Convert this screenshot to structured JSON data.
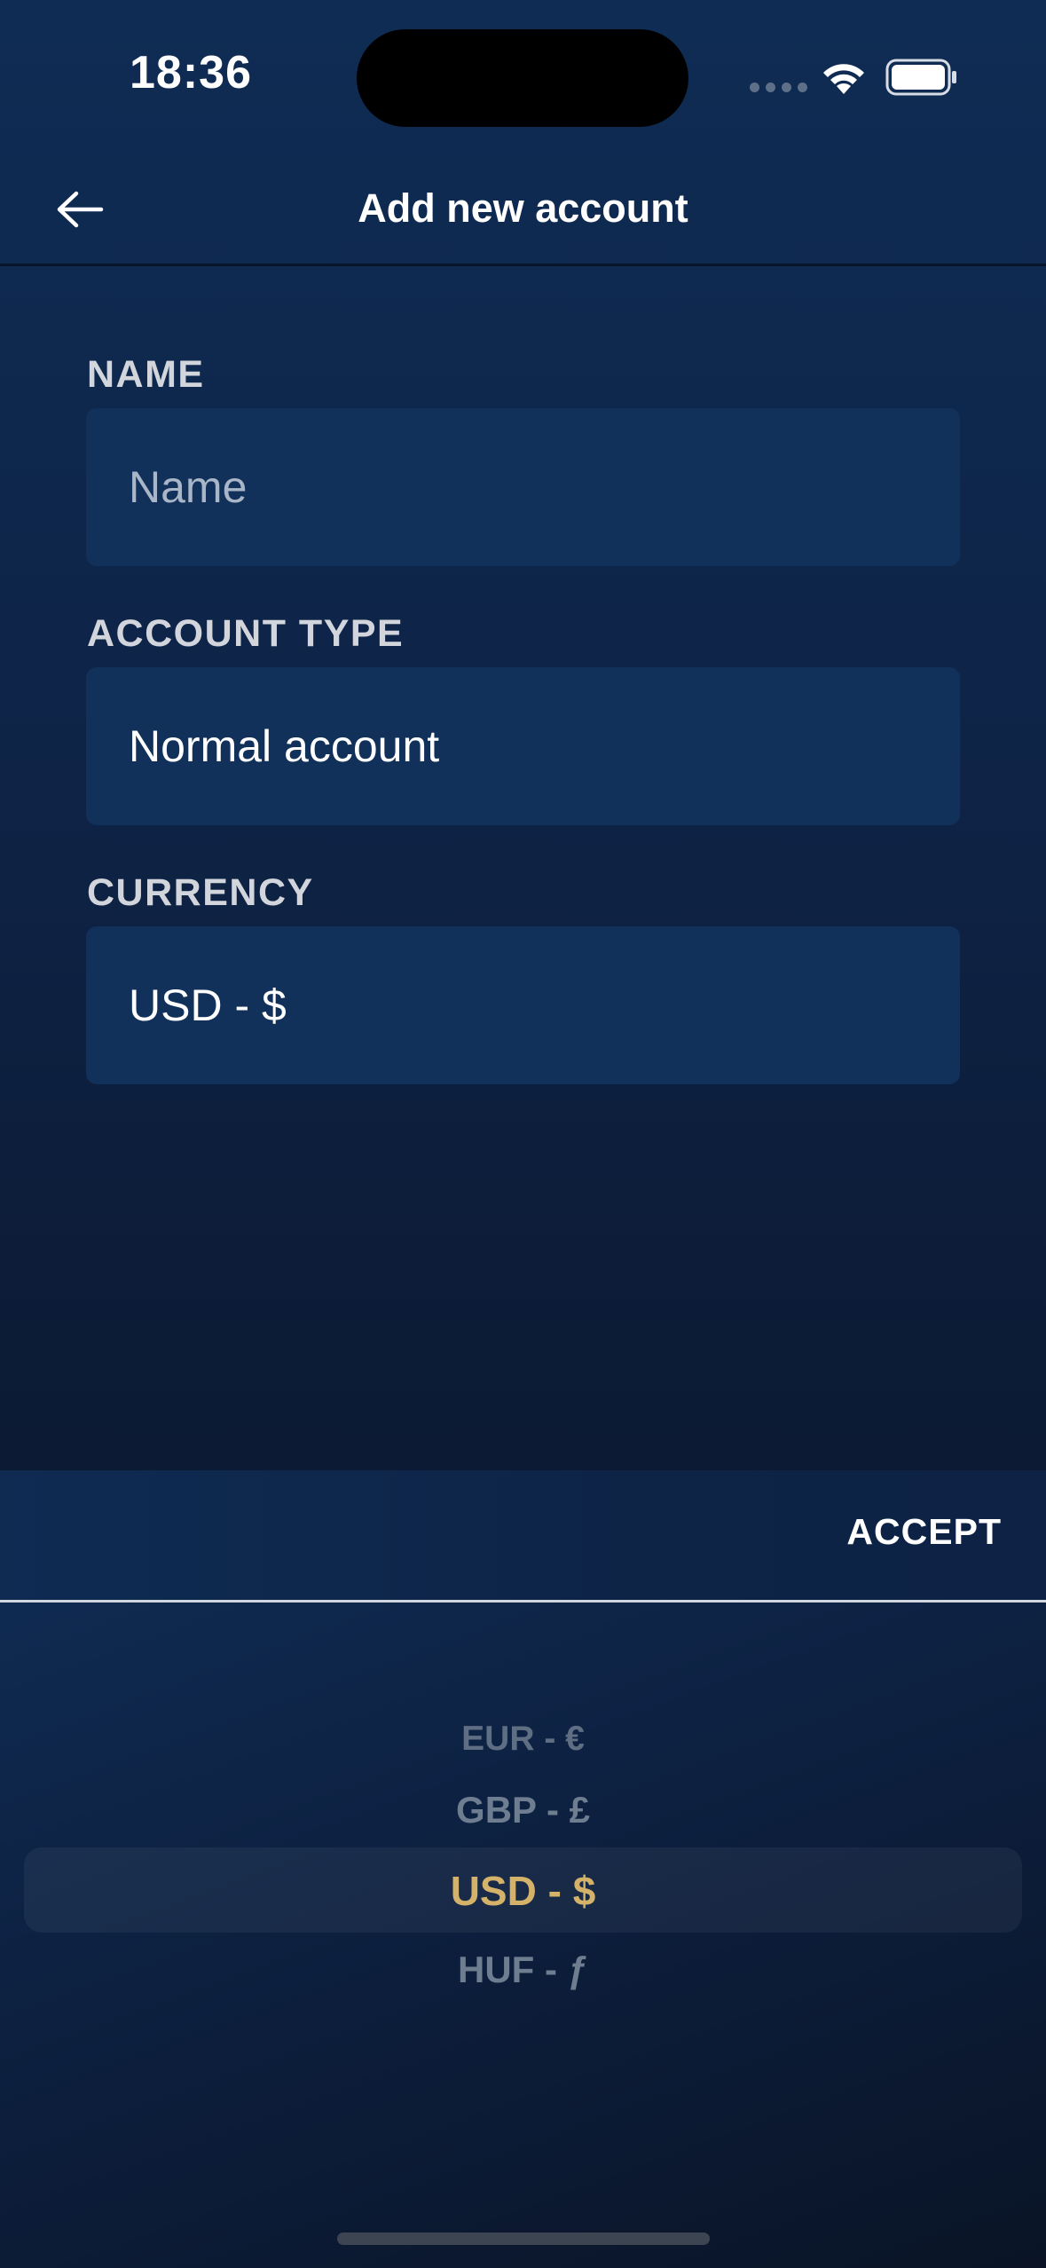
{
  "status_bar": {
    "time": "18:36"
  },
  "header": {
    "title": "Add new account",
    "back_icon": "arrow-left-icon"
  },
  "form": {
    "name": {
      "label": "NAME",
      "placeholder": "Name",
      "value": ""
    },
    "account_type": {
      "label": "ACCOUNT TYPE",
      "value": "Normal account"
    },
    "currency": {
      "label": "CURRENCY",
      "value": "USD - $"
    }
  },
  "picker": {
    "accept_label": "ACCEPT",
    "options": [
      "EUR - €",
      "GBP - £",
      "USD - $",
      "HUF - ƒ"
    ],
    "selected": "USD - $"
  },
  "colors": {
    "background": "#0e2346",
    "field_background": "#11305a",
    "selected_option": "#d4b26a"
  }
}
